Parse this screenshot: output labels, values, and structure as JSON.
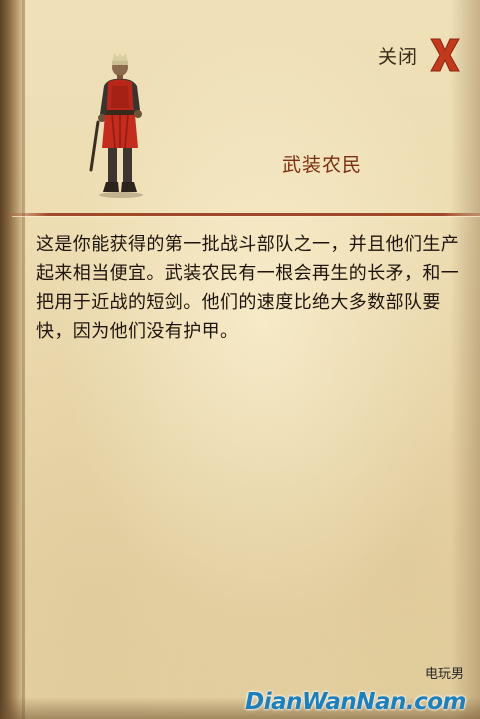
{
  "header": {
    "close_label": "关闭"
  },
  "unit": {
    "name": "武装农民",
    "description": "这是你能获得的第一批战斗部队之一，并且他们生产起来相当便宜。武装农民有一根会再生的长矛，和一把用于近战的短剑。他们的速度比绝大多数部队要快，因为他们没有护甲。"
  },
  "watermark": {
    "cn": "电玩男",
    "en": "DianWanNan.com"
  },
  "colors": {
    "close_x": "#c23a1c",
    "unit_name": "#7a2f12",
    "divider": "#a0482a",
    "parchment": "#eddcb1"
  }
}
